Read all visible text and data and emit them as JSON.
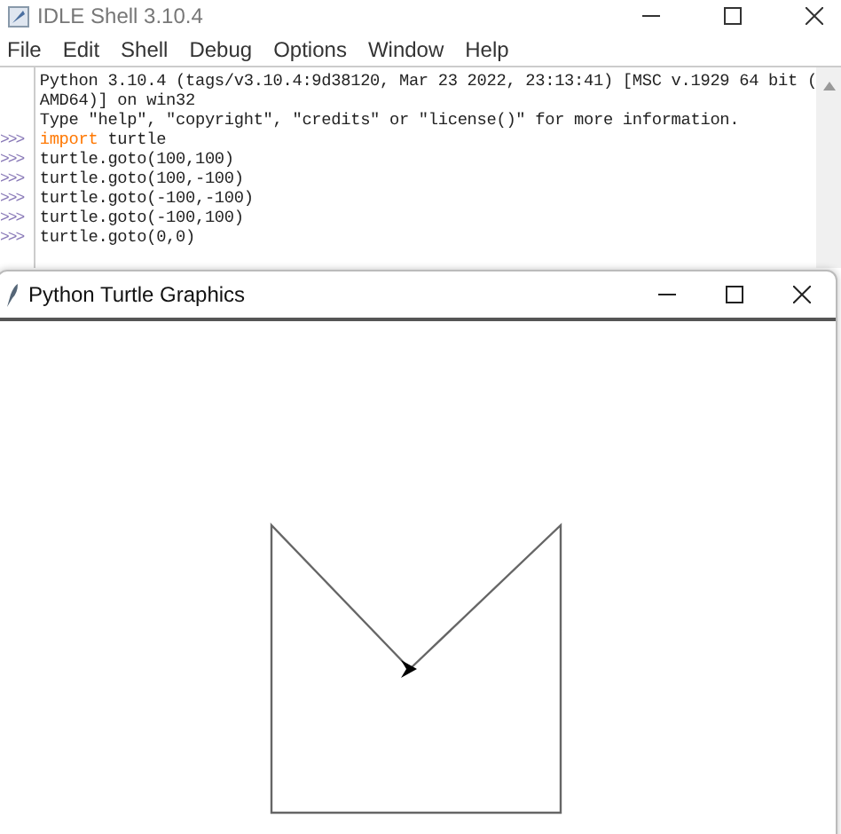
{
  "idle_window": {
    "title": "IDLE Shell 3.10.4",
    "menu": [
      "File",
      "Edit",
      "Shell",
      "Debug",
      "Options",
      "Window",
      "Help"
    ],
    "shell_lines": [
      {
        "kind": "output",
        "text": "Python 3.10.4 (tags/v3.10.4:9d38120, Mar 23 2022, 23:13:41) [MSC v.1929 64 bit ("
      },
      {
        "kind": "output",
        "text": "AMD64)] on win32"
      },
      {
        "kind": "output",
        "text": "Type \"help\", \"copyright\", \"credits\" or \"license()\" for more information."
      },
      {
        "kind": "input",
        "prompt": ">>>",
        "keyword": "import",
        "text": " turtle"
      },
      {
        "kind": "input",
        "prompt": ">>>",
        "text": "turtle.goto(100,100)"
      },
      {
        "kind": "input",
        "prompt": ">>>",
        "text": "turtle.goto(100,-100)"
      },
      {
        "kind": "input",
        "prompt": ">>>",
        "text": "turtle.goto(-100,-100)"
      },
      {
        "kind": "input",
        "prompt": ">>>",
        "text": "turtle.goto(-100,100)"
      },
      {
        "kind": "input",
        "prompt": ">>>",
        "text": "turtle.goto(0,0)"
      }
    ]
  },
  "turtle_window": {
    "title": "Python Turtle Graphics"
  }
}
